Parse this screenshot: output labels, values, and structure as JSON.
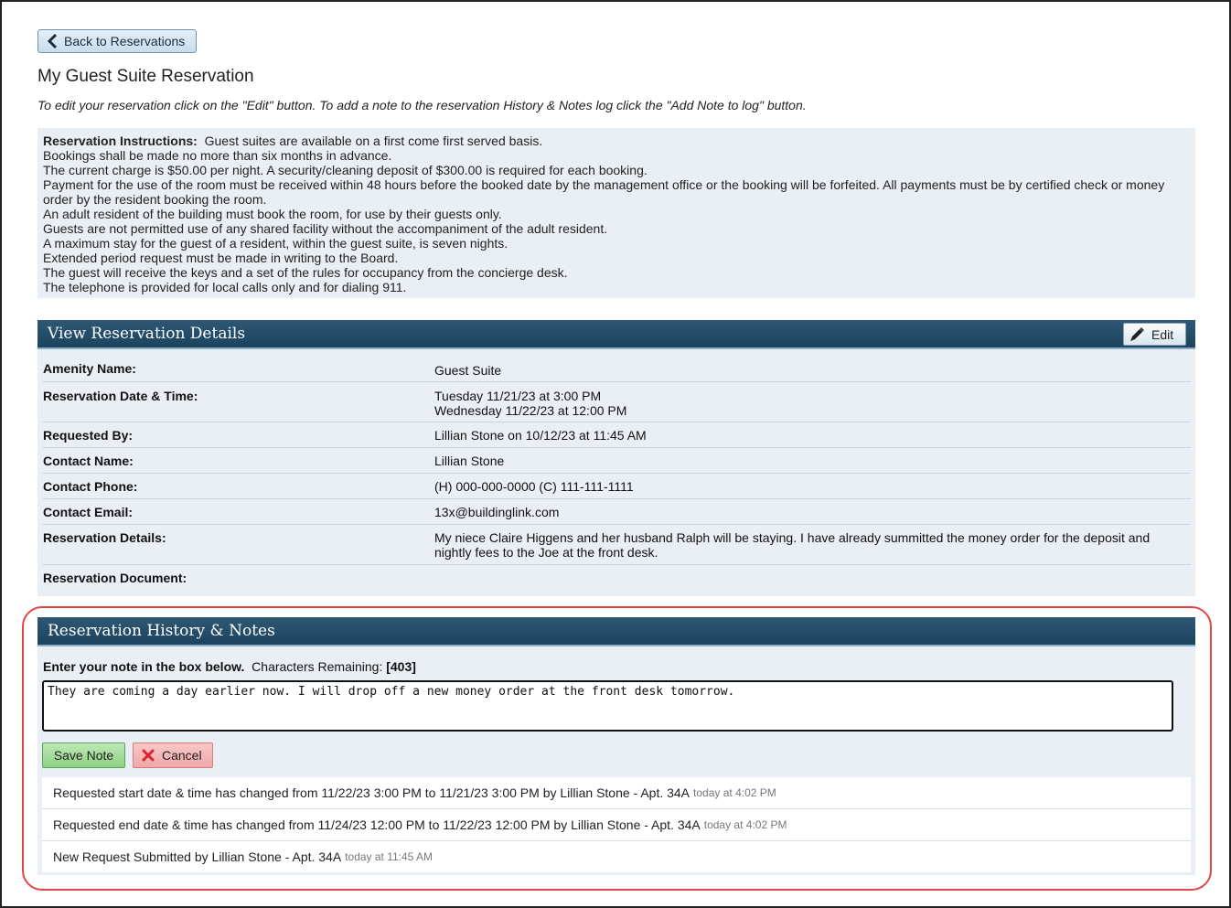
{
  "back_button": {
    "label": "Back to Reservations"
  },
  "page_title": "My Guest Suite Reservation",
  "instruction_line": "To edit your reservation click on the \"Edit\" button. To add a note to the reservation History & Notes log click the \"Add Note to log\" button.",
  "reservation_instructions": {
    "heading": "Reservation Instructions:",
    "first_line": "Guest suites are available on a first come first served basis.",
    "lines": [
      "Bookings shall be made no more than six months in advance.",
      "The current charge is $50.00 per night. A security/cleaning deposit of $300.00 is required for each booking.",
      "Payment for the use of the room must be received within 48 hours before the booked date by the management office or the booking will be forfeited. All payments must be by certified check or money order by the resident booking the room.",
      "An adult resident of the building must book the room, for use by their guests only.",
      "Guests are not permitted use of any shared facility without the accompaniment of the adult resident.",
      "A maximum stay for the guest of a resident, within the guest suite, is seven nights.",
      "Extended period request must be made in writing to the Board.",
      "The guest will receive the keys and a set of the rules for occupancy from the concierge desk.",
      "The telephone is provided for local calls only and for dialing 911."
    ]
  },
  "details_panel": {
    "title": "View Reservation Details",
    "edit_label": "Edit",
    "rows": [
      {
        "label": "Amenity Name:",
        "value": "Guest Suite"
      },
      {
        "label": "Reservation Date & Time:",
        "value": "Tuesday 11/21/23 at 3:00 PM",
        "value2": "Wednesday 11/22/23 at 12:00 PM"
      },
      {
        "label": "Requested By:",
        "value": "Lillian Stone on 10/12/23 at 11:45 AM"
      },
      {
        "label": "Contact Name:",
        "value": "Lillian Stone"
      },
      {
        "label": "Contact Phone:",
        "value": "(H) 000-000-0000 (C) 111-111-1111"
      },
      {
        "label": "Contact Email:",
        "value": "13x@buildinglink.com"
      },
      {
        "label": "Reservation Details:",
        "value": "My niece Claire Higgens and her husband Ralph will be staying. I have already summitted the money order for the deposit and nightly fees to the Joe at the front desk."
      },
      {
        "label": "Reservation Document:",
        "value": ""
      }
    ]
  },
  "history_panel": {
    "title": "Reservation History & Notes",
    "note_prompt": "Enter your note in the box below.",
    "chars_label": "Characters Remaining:",
    "chars_value": "[403]",
    "note_text": "They are coming a day earlier now. I will drop off a new money order at the front desk tomorrow.",
    "save_label": "Save Note",
    "cancel_label": "Cancel",
    "log": [
      {
        "text": "Requested start date & time has changed from 11/22/23 3:00 PM to 11/21/23 3:00 PM by Lillian Stone - Apt. 34A",
        "time": "today at 4:02 PM"
      },
      {
        "text": "Requested end date & time has changed from 11/24/23 12:00 PM to 11/22/23 12:00 PM by Lillian Stone - Apt. 34A",
        "time": "today at 4:02 PM"
      },
      {
        "text": "New Request Submitted by Lillian Stone - Apt. 34A",
        "time": "today at 11:45 AM"
      }
    ]
  },
  "colors": {
    "panel_header": "#1d435e",
    "panel_body": "#e9eff5",
    "highlight_border": "#e04646",
    "save_green": "#8fd084",
    "cancel_red": "#f0a8a8"
  }
}
